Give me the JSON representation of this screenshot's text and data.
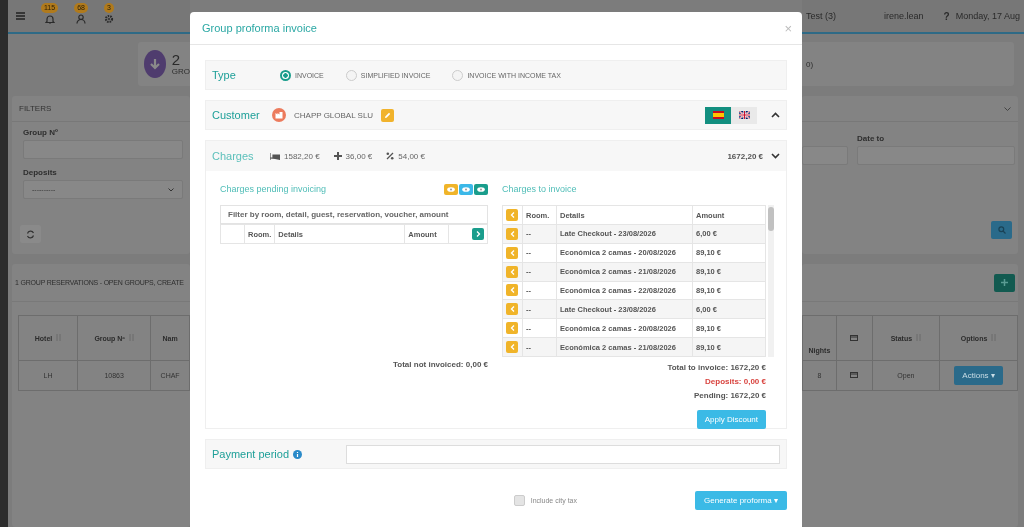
{
  "topbar": {
    "badges": [
      {
        "kind": "bell",
        "count": "115"
      },
      {
        "kind": "user",
        "count": "68"
      },
      {
        "kind": "gear",
        "count": "3"
      }
    ],
    "hotel": "Test (3)",
    "user": "irene.lean",
    "help": "?",
    "date": "Monday, 17 Aug"
  },
  "stat_card": {
    "value": "2",
    "label": "GRO",
    "right_text": "0)"
  },
  "filters": {
    "title": "FILTERS",
    "group_label": "Group Nº",
    "deposits_label": "Deposits",
    "deposits_value": "----------",
    "date_to_label": "Date to"
  },
  "reservations": {
    "title": "1 GROUP RESERVATIONS - OPEN GROUPS, CREATE",
    "left_columns": [
      "Hotel",
      "Group Nº",
      "Nam"
    ],
    "left_row": [
      "LH",
      "10863",
      "CHAF"
    ],
    "nights_header": "Nights",
    "nights_value": "8",
    "status_header": "Status",
    "options_header": "Options",
    "status_value": "Open",
    "actions": "Actions",
    "actions_caret": "▾"
  },
  "modal": {
    "title": "Group proforma invoice",
    "close": "×",
    "type": {
      "label": "Type",
      "options": [
        {
          "label": "INVOICE",
          "selected": true
        },
        {
          "label": "SIMPLIFIED INVOICE",
          "selected": false
        },
        {
          "label": "INVOICE WITH INCOME TAX",
          "selected": false
        }
      ]
    },
    "customer": {
      "label": "Customer",
      "name": "CHAPP GLOBAL SLU",
      "languages": [
        {
          "kind": "es",
          "selected": true
        },
        {
          "kind": "gb",
          "selected": false
        }
      ],
      "expanded": true
    },
    "charges": {
      "label": "Charges",
      "summary": [
        {
          "kind": "bed",
          "value": "1582,20 €"
        },
        {
          "kind": "plus",
          "value": "36,00 €"
        },
        {
          "kind": "percent",
          "value": "54,00 €"
        }
      ],
      "total": "1672,20 €",
      "expanded": true,
      "pending": {
        "title": "Charges pending invoicing",
        "view_buttons": [
          {
            "color": "#f0b429"
          },
          {
            "color": "#3bb8e8"
          },
          {
            "color": "#1a9d8c"
          }
        ],
        "filter_placeholder": "Filter by room, detail, guest, reservation, voucher, amount",
        "columns": [
          "Room.",
          "Details",
          "Amount"
        ],
        "total": "Total not invoiced: 0,00 €"
      },
      "to_invoice": {
        "title": "Charges to invoice",
        "columns": [
          "Room.",
          "Details",
          "Amount"
        ],
        "rows": [
          {
            "room": "--",
            "details": "Late Checkout - 23/08/2026",
            "amount": "6,00 €"
          },
          {
            "room": "--",
            "details": "Económica 2 camas - 20/08/2026",
            "amount": "89,10 €"
          },
          {
            "room": "--",
            "details": "Económica 2 camas - 21/08/2026",
            "amount": "89,10 €"
          },
          {
            "room": "--",
            "details": "Económica 2 camas - 22/08/2026",
            "amount": "89,10 €"
          },
          {
            "room": "--",
            "details": "Late Checkout - 23/08/2026",
            "amount": "6,00 €"
          },
          {
            "room": "--",
            "details": "Económica 2 camas - 20/08/2026",
            "amount": "89,10 €"
          },
          {
            "room": "--",
            "details": "Económica 2 camas - 21/08/2026",
            "amount": "89,10 €"
          }
        ],
        "total": "Total to invoice: 1672,20 €",
        "deposits": "Deposits: 0,00 €",
        "pending": "Pending: 1672,20 €",
        "discount_button": "Apply Discount"
      }
    },
    "payment": {
      "label": "Payment period"
    },
    "city_tax": {
      "label": "Include city tax",
      "checked": false,
      "disabled": true
    },
    "generate_button": "Generate proforma",
    "generate_caret": "▾"
  }
}
